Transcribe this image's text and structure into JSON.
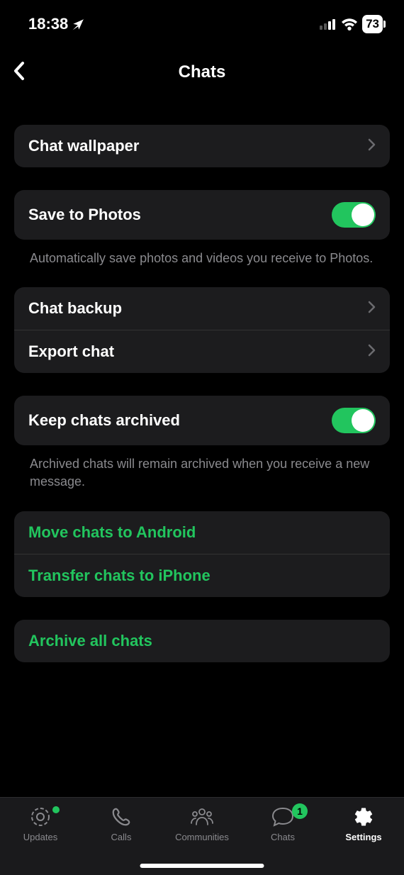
{
  "status": {
    "time": "18:38",
    "battery": "73"
  },
  "header": {
    "title": "Chats"
  },
  "rows": {
    "wallpaper": "Chat wallpaper",
    "save_photos": "Save to Photos",
    "save_photos_footer": "Automatically save photos and videos you receive to Photos.",
    "backup": "Chat backup",
    "export": "Export chat",
    "keep_archived": "Keep chats archived",
    "keep_archived_footer": "Archived chats will remain archived when you receive a new message.",
    "move_android": "Move chats to Android",
    "transfer_iphone": "Transfer chats to iPhone",
    "archive_all": "Archive all chats"
  },
  "tabs": {
    "updates": "Updates",
    "calls": "Calls",
    "communities": "Communities",
    "chats": "Chats",
    "chats_badge": "1",
    "settings": "Settings"
  }
}
